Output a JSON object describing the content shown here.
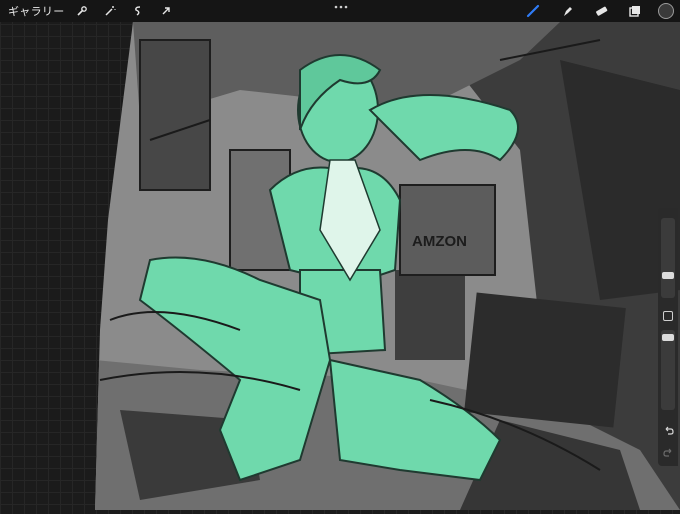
{
  "toolbar": {
    "gallery_label": "ギャラリー",
    "left_tools": [
      "wrench-icon",
      "magic-wand-icon",
      "selection-icon",
      "transform-arrow-icon"
    ],
    "right_tools": [
      "brush-icon",
      "smudge-icon",
      "eraser-icon",
      "layers-icon"
    ],
    "active_tool": "brush-icon",
    "accent_color": "#2f7cf6",
    "current_color": "#3a3a3a"
  },
  "canvas": {
    "description_colors": {
      "paper": "#8a8a8a",
      "ink": "#1e1e1e",
      "highlight": "#6fd9ac"
    },
    "sign_text": "AMZON"
  },
  "sidebar": {
    "brush_size_fraction": 0.55,
    "opacity_fraction": 0.85
  }
}
